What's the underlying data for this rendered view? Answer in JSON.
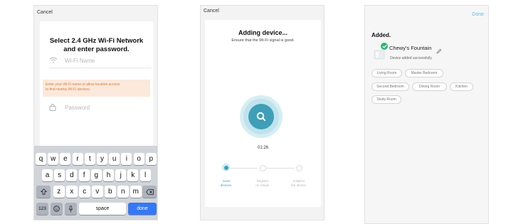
{
  "screen1": {
    "cancel": "Cancel",
    "title_line1": "Select 2.4 GHz Wi-Fi Network",
    "title_line2": "and enter password.",
    "wifi_placeholder": "Wi-Fi Name",
    "warning_line1": "Enter your Wi-Fi name or allow location access",
    "warning_line2": "to find nearby Wi-Fi devices.",
    "password_placeholder": "Password",
    "keyboard": {
      "row1": [
        "q",
        "w",
        "e",
        "r",
        "t",
        "y",
        "u",
        "i",
        "o",
        "p"
      ],
      "row2": [
        "a",
        "s",
        "d",
        "f",
        "g",
        "h",
        "j",
        "k",
        "l"
      ],
      "row3": [
        "z",
        "x",
        "c",
        "v",
        "b",
        "n",
        "m"
      ],
      "numbers_key": "123",
      "space_key": "space",
      "done_key": "done"
    }
  },
  "screen2": {
    "cancel": "Cancel",
    "title": "Adding device...",
    "subtitle": "Ensure that the Wi-Fi signal is good.",
    "timer": "01:26",
    "steps": [
      {
        "line1": "Scan",
        "line2": "devices."
      },
      {
        "line1": "Register",
        "line2": "on Cloud."
      },
      {
        "line1": "Initialize",
        "line2": "the device."
      }
    ]
  },
  "screen3": {
    "done": "Done",
    "added": "Added.",
    "device_name": "Chewy's Fountain",
    "device_status": "Device added successfully",
    "rooms": [
      "Living Room",
      "Master Bedroom",
      "Second Bedroom",
      "Dining Room",
      "Kitchen",
      "Study Room"
    ]
  },
  "colors": {
    "accent_blue": "#3478f6",
    "teal": "#3e9fb7",
    "done_link": "#5bbde0",
    "warning_bg": "#fbe9dc",
    "warning_text": "#e07a3a",
    "success_green": "#2bb673"
  }
}
